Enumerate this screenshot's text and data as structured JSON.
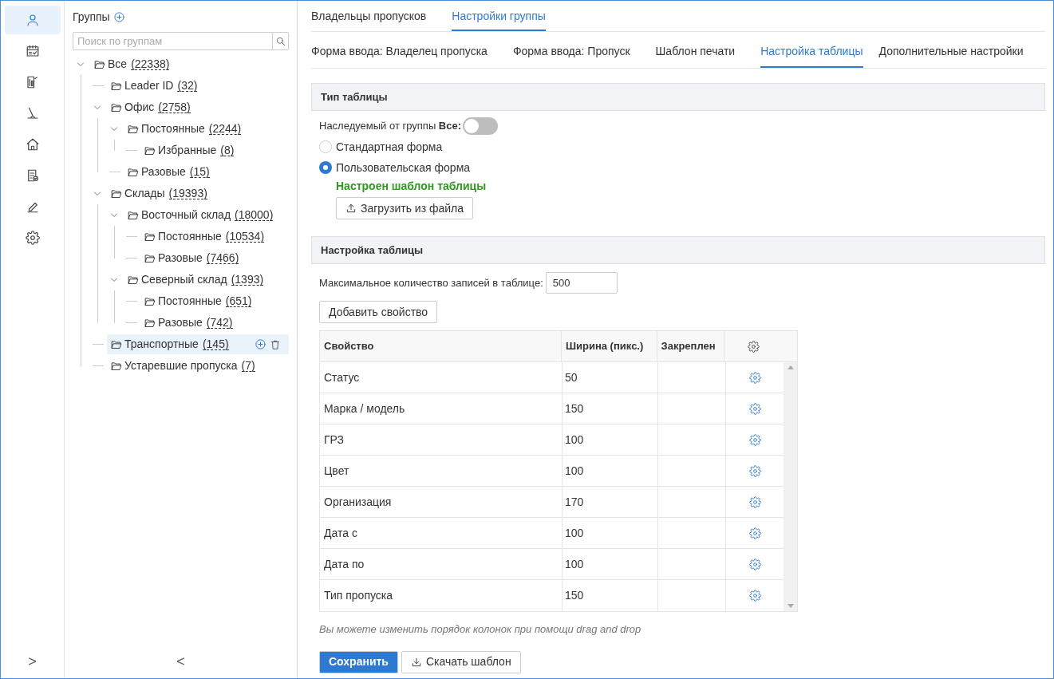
{
  "rail": {
    "items": [
      {
        "kind": "user",
        "selected": true
      },
      {
        "kind": "calendar",
        "selected": false
      },
      {
        "kind": "report",
        "selected": false
      },
      {
        "kind": "lever",
        "selected": false
      },
      {
        "kind": "home",
        "selected": false
      },
      {
        "kind": "doc",
        "selected": false
      },
      {
        "kind": "pen",
        "selected": false
      },
      {
        "kind": "gear",
        "selected": false
      }
    ],
    "expand": ">"
  },
  "groups": {
    "title": "Группы",
    "search_placeholder": "Поиск по группам",
    "collapse": "<",
    "tree": [
      {
        "label": "Все",
        "count": "(22338)",
        "expanded": true,
        "selected": false,
        "children": [
          {
            "label": "Leader ID",
            "count": "(32)",
            "selected": false
          },
          {
            "label": "Офис",
            "count": "(2758)",
            "expanded": true,
            "selected": false,
            "children": [
              {
                "label": "Постоянные",
                "count": "(2244)",
                "expanded": true,
                "selected": false,
                "children": [
                  {
                    "label": "Избранные",
                    "count": "(8)",
                    "selected": false
                  }
                ]
              },
              {
                "label": "Разовые",
                "count": "(15)",
                "selected": false
              }
            ]
          },
          {
            "label": "Склады",
            "count": "(19393)",
            "expanded": true,
            "selected": false,
            "children": [
              {
                "label": "Восточный склад",
                "count": "(18000)",
                "expanded": true,
                "selected": false,
                "children": [
                  {
                    "label": "Постоянные",
                    "count": "(10534)",
                    "selected": false
                  },
                  {
                    "label": "Разовые",
                    "count": "(7466)",
                    "selected": false
                  }
                ]
              },
              {
                "label": "Северный склад",
                "count": "(1393)",
                "expanded": true,
                "selected": false,
                "children": [
                  {
                    "label": "Постоянные",
                    "count": "(651)",
                    "selected": false
                  },
                  {
                    "label": "Разовые",
                    "count": "(742)",
                    "selected": false
                  }
                ]
              }
            ]
          },
          {
            "label": "Транспортные",
            "count": "(145)",
            "selected": true
          },
          {
            "label": "Устаревшие пропуска",
            "count": "(7)",
            "selected": false
          }
        ]
      }
    ]
  },
  "tabs": [
    {
      "label": "Владельцы пропусков",
      "selected": false
    },
    {
      "label": "Настройки группы",
      "selected": true
    }
  ],
  "subtabs": [
    {
      "label": "Форма ввода: Владелец пропуска",
      "selected": false
    },
    {
      "label": "Форма ввода: Пропуск",
      "selected": false
    },
    {
      "label": "Шаблон печати",
      "selected": false
    },
    {
      "label": "Настройка таблицы",
      "selected": true
    },
    {
      "label": "Дополнительные настройки",
      "selected": false
    }
  ],
  "table_type": {
    "title": "Тип таблицы",
    "inherit_label": "Наследуемый от группы **Все:**",
    "inherit_on": false,
    "options": [
      {
        "label": "Стандартная форма",
        "selected": false
      },
      {
        "label": "Пользовательская форма",
        "selected": true
      }
    ],
    "status": "Настроен шаблон таблицы",
    "upload_button": "Загрузить из файла"
  },
  "table_settings": {
    "title": "Настройка таблицы",
    "max_label": "Максимальное количество записей в таблице:",
    "max_value": "500",
    "add_button": "Добавить свойство",
    "columns": [
      "Свойство",
      "Ширина (пикс.)",
      "Закреплен"
    ],
    "rows": [
      [
        "Статус",
        "50"
      ],
      [
        "Марка / модель",
        "150"
      ],
      [
        "ГРЗ",
        "100"
      ],
      [
        "Цвет",
        "100"
      ],
      [
        "Организация",
        "170"
      ],
      [
        "Дата с",
        "100"
      ],
      [
        "Дата по",
        "100"
      ],
      [
        "Тип пропуска",
        "150"
      ]
    ],
    "hint": "Вы можете изменить порядок колонок при помощи drag and drop",
    "save_button": "Сохранить",
    "download_button": "Скачать шаблон"
  }
}
